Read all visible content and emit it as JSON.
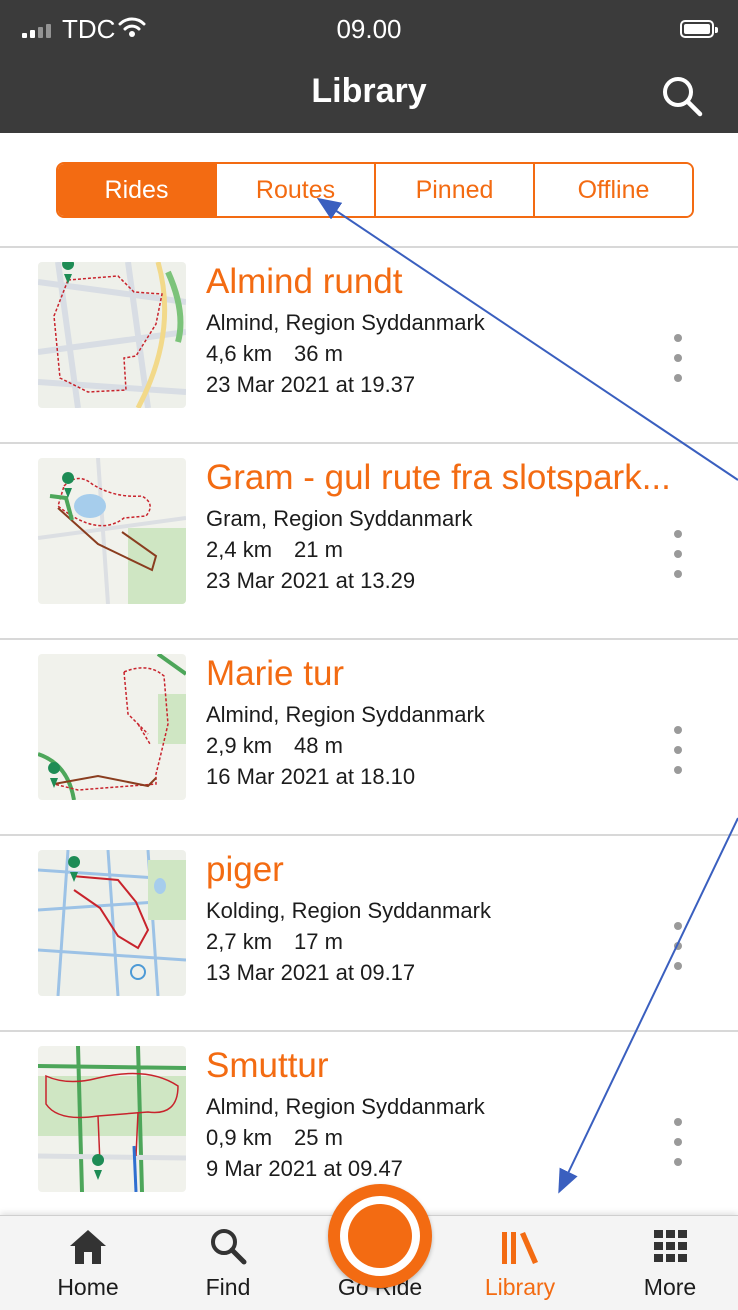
{
  "status_bar": {
    "carrier": "TDC",
    "time": "09.00"
  },
  "header": {
    "title": "Library",
    "search_icon": "search-icon"
  },
  "segments": [
    "Rides",
    "Routes",
    "Pinned",
    "Offline"
  ],
  "selected_segment": "Rides",
  "rides": [
    {
      "title": "Almind rundt",
      "place": "Almind, Region Syddanmark",
      "distance": "4,6 km",
      "elevation": "36 m",
      "date": "23 Mar 2021 at 19.37"
    },
    {
      "title": "Gram - gul rute fra slotspark...",
      "place": "Gram, Region Syddanmark",
      "distance": "2,4 km",
      "elevation": "21 m",
      "date": "23 Mar 2021 at 13.29"
    },
    {
      "title": "Marie tur",
      "place": "Almind, Region Syddanmark",
      "distance": "2,9 km",
      "elevation": "48 m",
      "date": "16 Mar 2021 at 18.10"
    },
    {
      "title": "piger",
      "place": "Kolding, Region Syddanmark",
      "distance": "2,7 km",
      "elevation": "17 m",
      "date": "13 Mar 2021 at 09.17"
    },
    {
      "title": "Smuttur",
      "place": "Almind, Region Syddanmark",
      "distance": "0,9 km",
      "elevation": "25 m",
      "date": "9 Mar 2021 at 09.47"
    }
  ],
  "tabbar": {
    "home": "Home",
    "find": "Find",
    "go_ride": "Go Ride",
    "library": "Library",
    "more": "More",
    "active": "Library"
  },
  "colors": {
    "accent": "#f36b12",
    "header_bg": "#3b3b3b",
    "annotation_arrow": "#3a5fbf"
  }
}
